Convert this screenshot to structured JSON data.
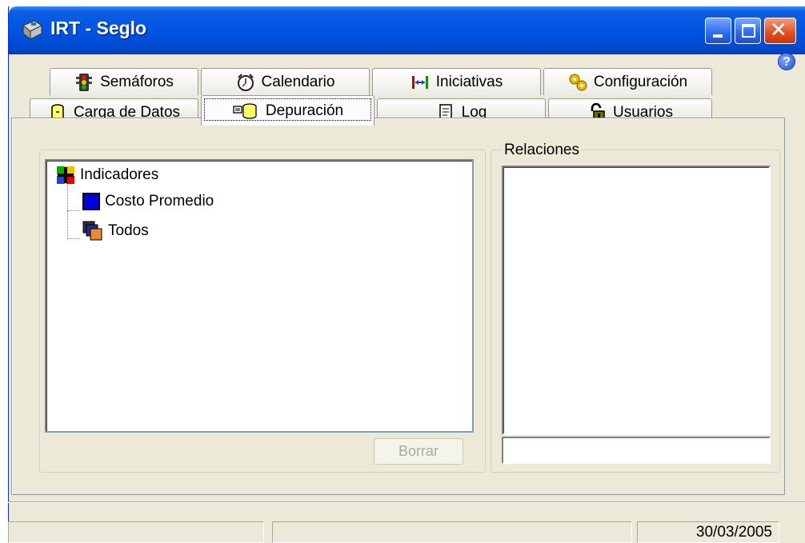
{
  "window": {
    "title": "IRT - Seglo"
  },
  "caption_buttons": {
    "minimize": "minimize-icon",
    "maximize": "maximize-icon",
    "close": "close-icon",
    "close_glyph": "✕"
  },
  "help": {
    "glyph": "?"
  },
  "tabs_row1": [
    {
      "label": "Semáforos",
      "icon": "traffic-light-icon"
    },
    {
      "label": "Calendario",
      "icon": "clock-icon"
    },
    {
      "label": "Iniciativas",
      "icon": "range-arrows-icon"
    },
    {
      "label": "Configuración",
      "icon": "gears-icon"
    }
  ],
  "tabs_row2": [
    {
      "label": "Carga de Datos",
      "icon": "database-icon"
    },
    {
      "label": "Depuración",
      "icon": "database-clean-icon",
      "active": true
    },
    {
      "label": "Log",
      "icon": "document-icon"
    },
    {
      "label": "Usuarios",
      "icon": "padlock-icon"
    }
  ],
  "tree": {
    "root": {
      "label": "Indicadores",
      "icon": "indicators-icon"
    },
    "children": [
      {
        "label": "Costo Promedio",
        "icon": "blue-square-icon"
      },
      {
        "label": "Todos",
        "icon": "stacked-squares-icon"
      }
    ]
  },
  "buttons": {
    "borrar": "Borrar"
  },
  "relaciones": {
    "legend": "Relaciones",
    "input_value": ""
  },
  "statusbar": {
    "panel1": "",
    "panel2": "",
    "date": "30/03/2005"
  }
}
